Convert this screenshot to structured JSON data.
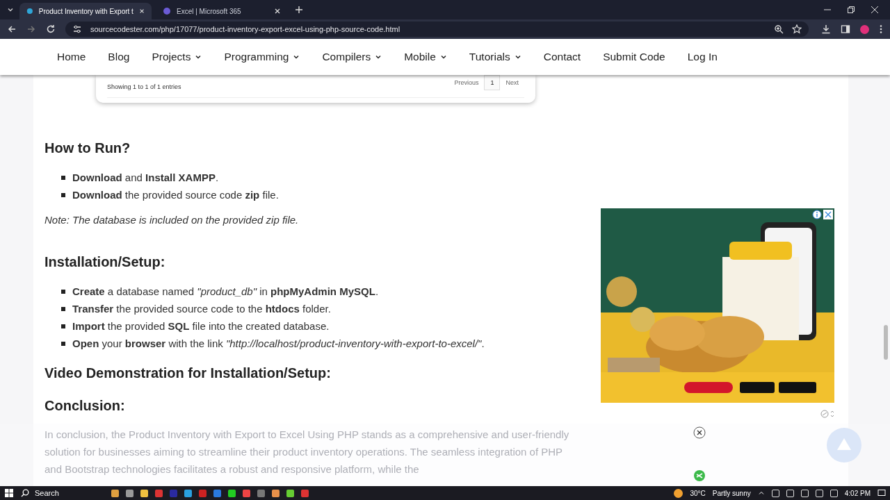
{
  "browser": {
    "tabs": [
      {
        "title": "Product Inventory with Export t",
        "selected": true
      },
      {
        "title": "Excel | Microsoft 365",
        "selected": false
      }
    ],
    "url": "sourcecodester.com/php/17077/product-inventory-export-excel-using-php-source-code.html"
  },
  "nav": [
    {
      "label": "Home",
      "dropdown": false
    },
    {
      "label": "Blog",
      "dropdown": false
    },
    {
      "label": "Projects",
      "dropdown": true
    },
    {
      "label": "Programming",
      "dropdown": true
    },
    {
      "label": "Compilers",
      "dropdown": true
    },
    {
      "label": "Mobile",
      "dropdown": true
    },
    {
      "label": "Tutorials",
      "dropdown": true
    },
    {
      "label": "Contact",
      "dropdown": false
    },
    {
      "label": "Submit Code",
      "dropdown": false
    },
    {
      "label": "Log In",
      "dropdown": false
    }
  ],
  "table_footer": {
    "info": "Showing 1 to 1 of 1 entries",
    "pagination": [
      {
        "label": "Previous",
        "selected": false
      },
      {
        "label": "1",
        "selected": true
      },
      {
        "label": "Next",
        "selected": false
      }
    ]
  },
  "sections": [
    {
      "heading": "How to Run?",
      "items": [
        "**Download** and **Install XAMPP**.",
        "**Download** the provided source code **zip** file."
      ],
      "note": "Note: The database is included on the provided zip file."
    },
    {
      "heading": "Installation/Setup:",
      "items": [
        "**Create** a database named *\"product_db\"* in **phpMyAdmin MySQL**.",
        "**Transfer** the provided source code to the **htdocs** folder.",
        "**Import** the provided **SQL** file into the created database.",
        "**Open** your **browser** with the link *\"http://localhost/product-inventory-with-export-to-excel/\"*."
      ]
    },
    {
      "heading": "Video Demonstration for Installation/Setup:"
    },
    {
      "heading": "Conclusion:",
      "paragraph": "In conclusion, the Product Inventory with Export to Excel Using PHP stands as a comprehensive and user-friendly solution for businesses aiming to streamline their product inventory operations. The seamless integration of PHP and Bootstrap technologies facilitates a robust and responsive platform, while the"
    }
  ],
  "taskbar": {
    "search": "Search",
    "temperature": "30°C",
    "weather": "Partly sunny",
    "time": "4:02 PM"
  }
}
